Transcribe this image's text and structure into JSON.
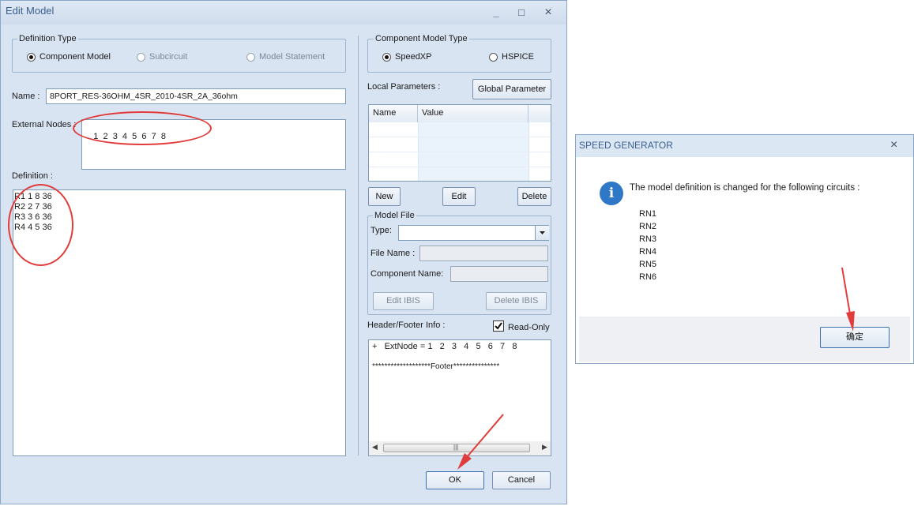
{
  "edit_model": {
    "title": "Edit Model",
    "controls": {
      "minimize": "_",
      "maximize": "□",
      "close": "×"
    },
    "definition_type": {
      "legend": "Definition Type",
      "options": [
        "Component Model",
        "Subcircuit",
        "Model Statement"
      ],
      "selected": "Component Model"
    },
    "name_label": "Name :",
    "name_value": "8PORT_RES-36OHM_4SR_2010-4SR_2A_36ohm",
    "external_nodes_label": "External Nodes :",
    "external_nodes_value": "1  2  3  4  5  6  7  8",
    "definition_label": "Definition :",
    "definition_lines": [
      "R1 1 8 36",
      "R2 2 7 36",
      "R3 3 6 36",
      "R4 4 5 36"
    ],
    "component_model_type": {
      "legend": "Component Model Type",
      "options": [
        "SpeedXP",
        "HSPICE"
      ],
      "selected": "SpeedXP"
    },
    "local_parameters_label": "Local Parameters :",
    "global_parameter_button": "Global Parameter",
    "params_table": {
      "columns": [
        "Name",
        "Value"
      ],
      "rows": []
    },
    "new_button": "New",
    "edit_button": "Edit",
    "delete_button": "Delete",
    "model_file": {
      "legend": "Model File",
      "type_label": "Type:",
      "type_value": "",
      "file_name_label": "File Name :",
      "component_name_label": "Component Name:",
      "edit_ibis_button": "Edit IBIS",
      "delete_ibis_button": "Delete IBIS"
    },
    "header_footer_label": "Header/Footer Info :",
    "read_only_label": "Read-Only",
    "read_only_checked": true,
    "header_footer_lines": [
      "+   ExtNode = 1   2   3   4   5   6   7   8",
      "*******************Footer***************"
    ],
    "scroll_grip": "|||",
    "ok_button": "OK",
    "cancel_button": "Cancel"
  },
  "dialog": {
    "title": "SPEED GENERATOR",
    "close": "×",
    "message": "The model definition is changed for the following circuits :",
    "circuits": [
      "RN1",
      "RN2",
      "RN3",
      "RN4",
      "RN5",
      "RN6"
    ],
    "confirm_button": "确定",
    "info_glyph": "i"
  },
  "colors": {
    "annotation": "#e23b3b",
    "window_bg": "#d8e4f2",
    "title_text": "#3a5f8f",
    "info_icon": "#2f78c8"
  },
  "icons": {
    "info": "info-icon",
    "close": "close-icon",
    "dropdown": "chevron-down-icon",
    "checkbox": "checkbox-icon"
  }
}
